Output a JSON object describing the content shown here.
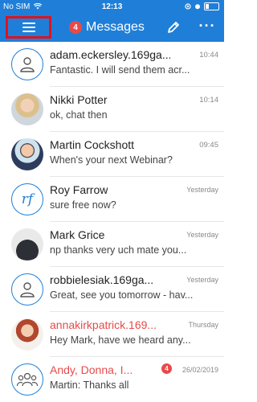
{
  "status_bar": {
    "carrier": "No SIM",
    "time": "12:13"
  },
  "nav": {
    "title": "Messages",
    "unread_count": "4",
    "more_label": "···"
  },
  "colors": {
    "accent": "#1f7fd8",
    "badge": "#e84a4a",
    "highlight_border": "#e0121e"
  },
  "conversations": [
    {
      "name": "adam.eckersley.169ga...",
      "preview": "Fantastic. I will send them acr...",
      "time": "10:44",
      "avatar": "user-outline-icon"
    },
    {
      "name": "Nikki Potter",
      "preview": "ok, chat then",
      "time": "10:14",
      "avatar": "photo"
    },
    {
      "name": "Martin Cockshott",
      "preview": "When's your next Webinar?",
      "time": "09:45",
      "avatar": "photo"
    },
    {
      "name": "Roy Farrow",
      "preview": "sure free now?",
      "time": "Yesterday",
      "avatar": "rf",
      "initials": "rf"
    },
    {
      "name": "Mark Grice",
      "preview": "np thanks very uch mate you...",
      "time": "Yesterday",
      "avatar": "photo"
    },
    {
      "name": "robbielesiak.169ga...",
      "preview": "Great, see you tomorrow - hav...",
      "time": "Yesterday",
      "avatar": "user-outline-icon"
    },
    {
      "name": "annakirkpatrick.169...",
      "preview": "Hey Mark, have we heard any...",
      "time": "Thursday",
      "avatar": "photo",
      "unread": true
    },
    {
      "name": "Andy, Donna, I...",
      "preview": "Martin: Thanks all",
      "time": "26/02/2019",
      "avatar": "group-icon",
      "unread": true,
      "badge": "4"
    }
  ]
}
